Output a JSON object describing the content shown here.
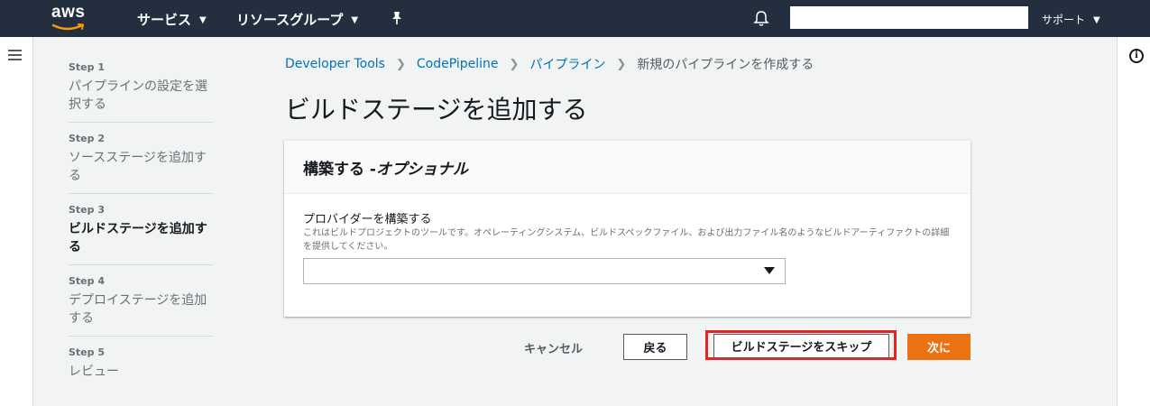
{
  "topnav": {
    "logo_text": "aws",
    "services": "サービス",
    "resource_groups": "リソースグループ",
    "account_value": "",
    "support": "サポート",
    "icons": [
      "hamburger-icon",
      "pin-icon",
      "bell-icon",
      "info-icon",
      "chevron-down-icon"
    ]
  },
  "colors": {
    "nav_bg": "#232f3e",
    "link": "#0073bb",
    "primary_button": "#ec7211",
    "highlight_box": "#e8251a"
  },
  "steps": [
    {
      "num": "Step 1",
      "title": "パイプラインの設定を選択する",
      "active": false
    },
    {
      "num": "Step 2",
      "title": "ソースステージを追加する",
      "active": false
    },
    {
      "num": "Step 3",
      "title": "ビルドステージを追加する",
      "active": true
    },
    {
      "num": "Step 4",
      "title": "デプロイステージを追加する",
      "active": false
    },
    {
      "num": "Step 5",
      "title": "レビュー",
      "active": false
    }
  ],
  "breadcrumb": {
    "items": [
      "Developer Tools",
      "CodePipeline",
      "パイプライン"
    ],
    "current": "新規のパイプラインを作成する"
  },
  "page": {
    "title": "ビルドステージを追加する"
  },
  "panel": {
    "header": "構築する - ",
    "header_optional": "オプショナル",
    "field_label": "プロバイダーを構築する",
    "field_description": "これはビルドプロジェクトのツールです。オペレーティングシステム、ビルドスペックファイル、および出力ファイル名のようなビルドアーティファクトの詳細を提供してください。",
    "select_value": ""
  },
  "footer": {
    "cancel": "キャンセル",
    "back": "戻る",
    "skip": "ビルドステージをスキップ",
    "next": "次に"
  }
}
